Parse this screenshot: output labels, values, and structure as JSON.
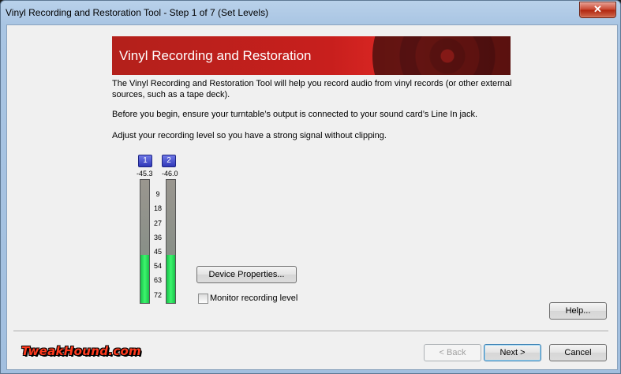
{
  "window": {
    "title": "Vinyl Recording and Restoration Tool - Step 1 of 7 (Set Levels)",
    "close_label": "✕"
  },
  "banner": {
    "title": "Vinyl Recording and Restoration"
  },
  "intro": {
    "line1": "The Vinyl Recording and Restoration Tool will help you record audio from vinyl records (or other external sources, such as a tape deck).",
    "line2": "Before you begin, ensure your turntable’s output is connected to your sound card’s Line In jack.",
    "line3": "Adjust your recording level so you have a strong signal without clipping."
  },
  "meters": {
    "channels": [
      {
        "label": "1",
        "value": "-45.3",
        "level_fraction": 0.39
      },
      {
        "label": "2",
        "value": "-46.0",
        "level_fraction": 0.39
      }
    ],
    "scale": [
      "9",
      "18",
      "27",
      "36",
      "45",
      "54",
      "63",
      "72"
    ],
    "fill_color": "#2ee85c"
  },
  "controls": {
    "device_properties_label": "Device Properties...",
    "monitor_label": "Monitor recording level",
    "monitor_checked": false
  },
  "footer": {
    "help_label": "Help...",
    "back_label": "< Back",
    "next_label": "Next >",
    "cancel_label": "Cancel"
  },
  "watermark": {
    "text": "TweakHound.com"
  }
}
